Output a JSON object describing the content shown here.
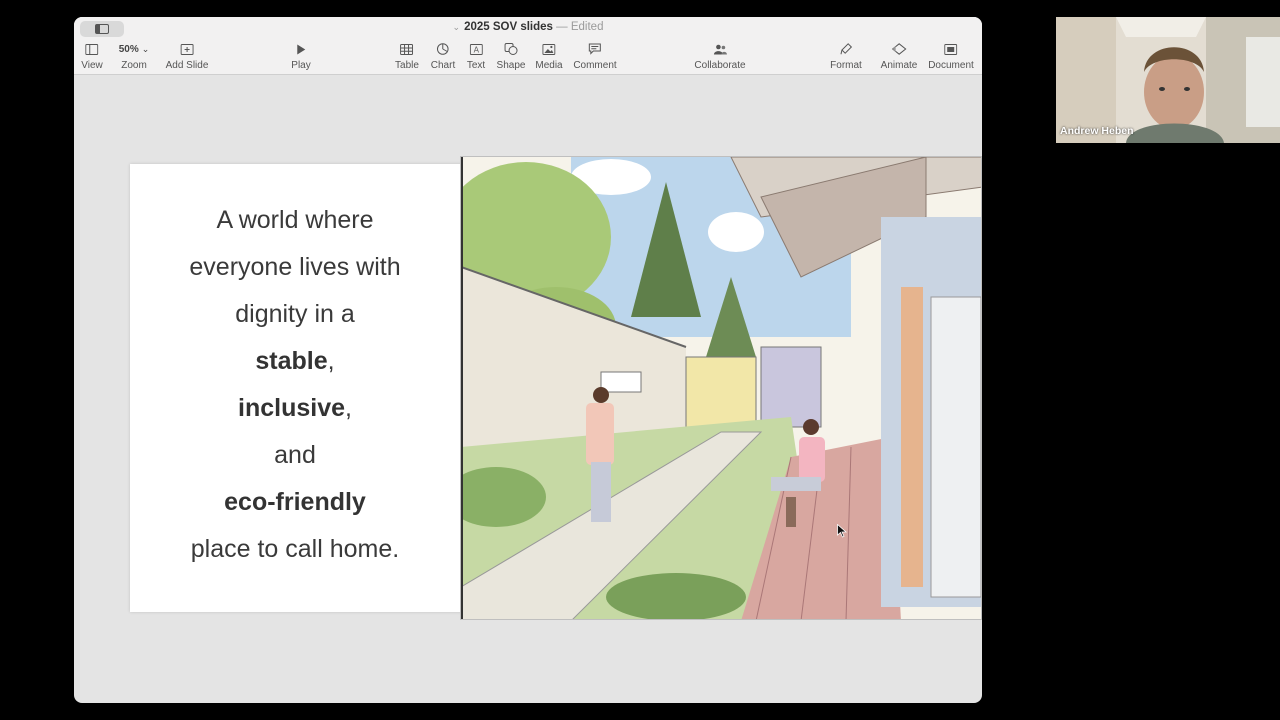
{
  "window": {
    "title": "2025 SOV slides",
    "edited_label": "Edited"
  },
  "toolbar": {
    "view": "View",
    "zoom": "Zoom",
    "zoom_value": "50%",
    "add_slide": "Add Slide",
    "play": "Play",
    "table": "Table",
    "chart": "Chart",
    "text": "Text",
    "shape": "Shape",
    "media": "Media",
    "comment": "Comment",
    "collaborate": "Collaborate",
    "format": "Format",
    "animate": "Animate",
    "document": "Document"
  },
  "slide": {
    "line1": "A world where",
    "line2": "everyone lives with",
    "line3": "dignity in a",
    "word_stable": "stable",
    "word_inclusive": "inclusive",
    "comma": ",",
    "line_and": "and",
    "word_eco": "eco-friendly",
    "line_last": "place to call home."
  },
  "video_call": {
    "participant_name": "Andrew Heben"
  },
  "colors": {
    "accent": "#3b82f6",
    "window_bg": "#e4e4e4",
    "toolbar_bg": "#f2f1f1",
    "slide_text": "#3a3a3a"
  },
  "icons": [
    "sidebar-icon",
    "view-icon",
    "zoom-chevron-icon",
    "add-slide-icon",
    "play-icon",
    "table-icon",
    "chart-icon",
    "text-icon",
    "shape-icon",
    "media-icon",
    "comment-icon",
    "collaborate-icon",
    "format-icon",
    "animate-icon",
    "document-icon"
  ]
}
